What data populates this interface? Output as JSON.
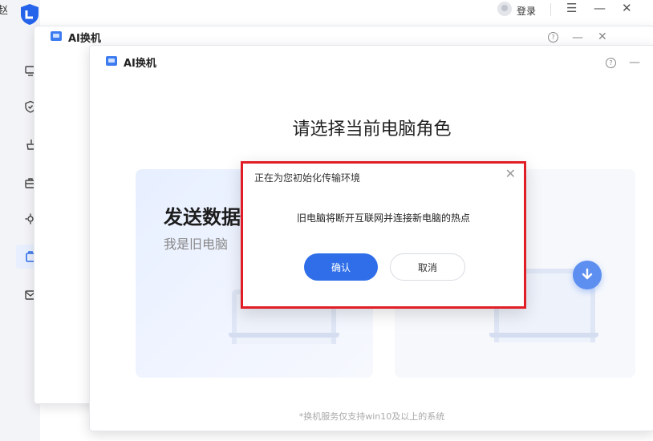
{
  "base_app": {
    "edge_char": "赵",
    "login_label": "登录",
    "menu_icon": "hamburger-icon",
    "minimize_glyph": "—",
    "close_glyph": "✕",
    "sidebar_icons": [
      "monitor-icon",
      "shield-icon",
      "broom-icon",
      "toolbox-icon",
      "gear-icon",
      "transfer-icon",
      "mail-icon"
    ]
  },
  "window_back": {
    "title": "AI换机",
    "help_glyph": "?",
    "minimize_glyph": "—",
    "close_glyph": "✕"
  },
  "window_front": {
    "title": "AI换机",
    "help_glyph": "?",
    "minimize_glyph": "—",
    "heading": "请选择当前电脑角色",
    "send_card": {
      "title": "发送数据",
      "subtitle": "我是旧电脑"
    },
    "receive_card": {
      "badge_icon": "download-arrow-icon"
    },
    "footer_note": "*换机服务仅支持win10及以上的系统"
  },
  "dialog": {
    "title": "正在为您初始化传输环境",
    "close_glyph": "✕",
    "message": "旧电脑将断开互联网并连接新电脑的热点",
    "confirm_label": "确认",
    "cancel_label": "取消"
  },
  "colors": {
    "accent": "#2f6ee8",
    "highlight_border": "#e11d25",
    "badge": "#5d8ff0"
  }
}
